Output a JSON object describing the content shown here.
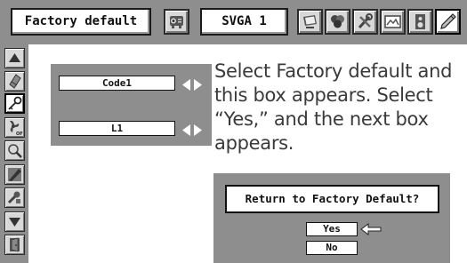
{
  "menu_bar": {
    "mode_label": "Factory default",
    "input_label": "SVGA 1",
    "icons": [
      "projector-icon",
      "monitor-icon",
      "color-icon",
      "tools-icon",
      "screen-icon",
      "sound-icon",
      "setting-icon"
    ],
    "active_icon": "setting-icon"
  },
  "side_menu": {
    "items": [
      "up-arrow-icon",
      "eraser-icon",
      "key-icon",
      "fan-off-icon",
      "brush-icon",
      "pencil-icon",
      "tool-icon",
      "down-arrow-icon",
      "exit-icon"
    ],
    "active_item": "key-icon"
  },
  "submenu": {
    "code_value": "Code1",
    "level_value": "L1"
  },
  "instructions": {
    "text": "Select Factory default and this box appears.  Select “Yes,” and the next box appears."
  },
  "dialog": {
    "title": "Return to Factory Default?",
    "yes_label": "Yes",
    "no_label": "No",
    "selected": "Yes"
  },
  "colors": {
    "panel_gray": "#8e8e8e",
    "button_gray": "#d8d8d8",
    "text": "#3a3a3a"
  }
}
